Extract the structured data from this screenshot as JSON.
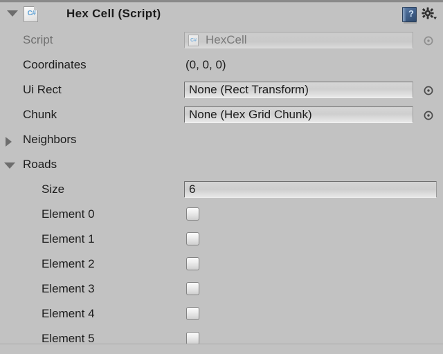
{
  "window": {
    "background_color": "#c2c2c2"
  },
  "header": {
    "title": "Hex Cell (Script)",
    "foldout_state": "expanded",
    "script_icon_label": "C#",
    "help_icon_glyph": "?",
    "icons": {
      "foldout": "triangle-down-icon",
      "script": "csharp-script-icon",
      "help": "help-book-icon",
      "settings": "gear-dropdown-icon"
    }
  },
  "properties": [
    {
      "label": "Script",
      "type": "object-field",
      "value": "HexCell",
      "disabled": true,
      "icon_label": "C#",
      "has_picker": true,
      "indent": 0
    },
    {
      "label": "Coordinates",
      "type": "text",
      "value": "(0, 0, 0)",
      "disabled": false,
      "has_picker": false,
      "indent": 0
    },
    {
      "label": "Ui Rect",
      "type": "object-field",
      "value": "None (Rect Transform)",
      "disabled": false,
      "has_picker": true,
      "indent": 0
    },
    {
      "label": "Chunk",
      "type": "object-field",
      "value": "None (Hex Grid Chunk)",
      "disabled": false,
      "has_picker": true,
      "indent": 0
    }
  ],
  "foldouts": [
    {
      "label": "Neighbors",
      "state": "collapsed",
      "icon": "triangle-right-icon"
    },
    {
      "label": "Roads",
      "state": "expanded",
      "icon": "triangle-down-icon"
    }
  ],
  "array": {
    "size_label": "Size",
    "size_value": "6",
    "elements": [
      {
        "label": "Element 0",
        "checked": false
      },
      {
        "label": "Element 1",
        "checked": false
      },
      {
        "label": "Element 2",
        "checked": false
      },
      {
        "label": "Element 3",
        "checked": false
      },
      {
        "label": "Element 4",
        "checked": false
      },
      {
        "label": "Element 5",
        "checked": false
      }
    ]
  }
}
